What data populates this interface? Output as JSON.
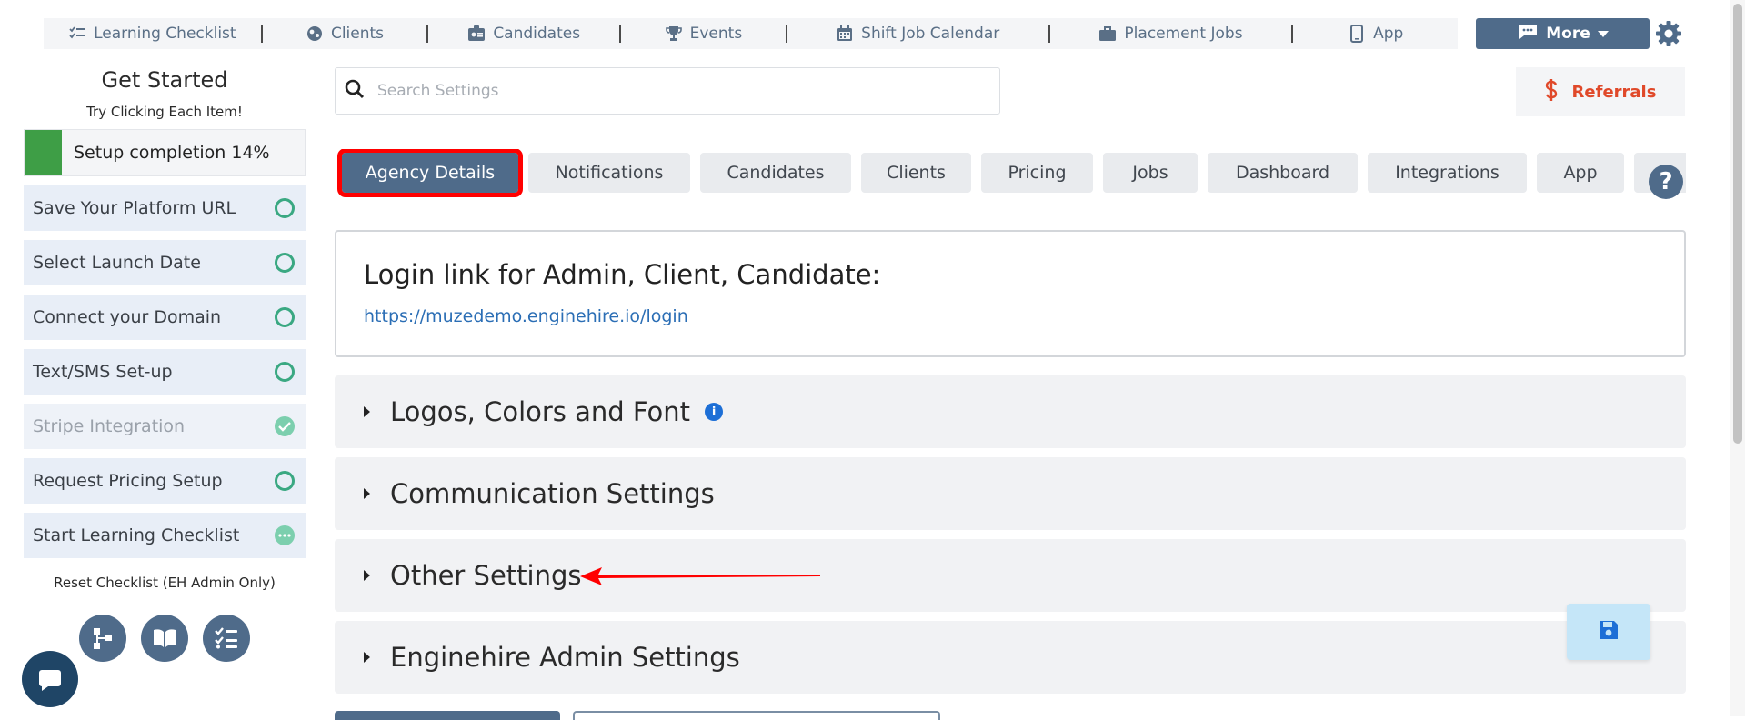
{
  "nav": {
    "items": [
      {
        "label": "Learning Checklist",
        "icon": "checklist-icon"
      },
      {
        "label": "Clients",
        "icon": "globe-icon"
      },
      {
        "label": "Candidates",
        "icon": "id-badge-icon"
      },
      {
        "label": "Events",
        "icon": "trophy-icon"
      },
      {
        "label": "Shift Job Calendar",
        "icon": "calendar-icon"
      },
      {
        "label": "Placement Jobs",
        "icon": "briefcase-icon"
      },
      {
        "label": "App",
        "icon": "mobile-icon"
      }
    ],
    "more_label": "More"
  },
  "sidebar": {
    "title": "Get Started",
    "subtitle": "Try Clicking Each Item!",
    "progress_label": "Setup completion 14%",
    "progress_percent": 14,
    "items": [
      {
        "label": "Save Your Platform URL",
        "status": "open"
      },
      {
        "label": "Select Launch Date",
        "status": "open"
      },
      {
        "label": "Connect your Domain",
        "status": "open"
      },
      {
        "label": "Text/SMS Set-up",
        "status": "open"
      },
      {
        "label": "Stripe Integration",
        "status": "done"
      },
      {
        "label": "Request Pricing Setup",
        "status": "open"
      },
      {
        "label": "Start Learning Checklist",
        "status": "in-progress"
      }
    ],
    "reset_label": "Reset Checklist (EH Admin Only)"
  },
  "search": {
    "placeholder": "Search Settings",
    "value": ""
  },
  "referrals_label": "Referrals",
  "tabs": [
    {
      "label": "Agency Details",
      "active": true
    },
    {
      "label": "Notifications"
    },
    {
      "label": "Candidates"
    },
    {
      "label": "Clients"
    },
    {
      "label": "Pricing"
    },
    {
      "label": "Jobs"
    },
    {
      "label": "Dashboard"
    },
    {
      "label": "Integrations"
    },
    {
      "label": "App"
    }
  ],
  "login": {
    "title": "Login link for Admin, Client, Candidate:",
    "link": "https://muzedemo.enginehire.io/login"
  },
  "sections": [
    {
      "label": "Logos, Colors and Font"
    },
    {
      "label": "Communication Settings"
    },
    {
      "label": "Other Settings"
    },
    {
      "label": "Enginehire Admin Settings"
    }
  ],
  "info_glyph": "i",
  "help_glyph": "?",
  "colors": {
    "accent": "#4f6b8a",
    "success": "#3e9e46",
    "referral": "#e0492a",
    "highlight": "#ff0000"
  }
}
